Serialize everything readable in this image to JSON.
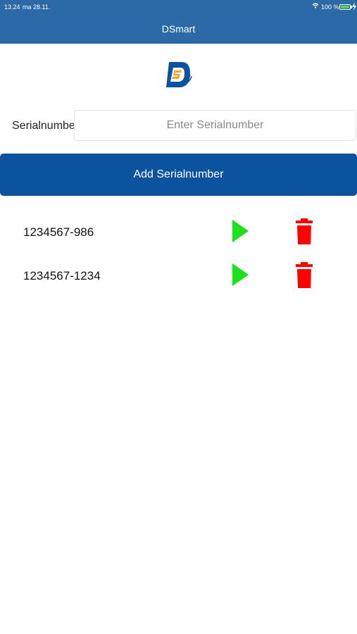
{
  "status_bar": {
    "time": "13.24",
    "date": "ma 28.11.",
    "battery_pct": "100 %",
    "icons": [
      "wifi-icon",
      "battery-icon",
      "charging-icon"
    ],
    "colors": {
      "battery_fill": "#52d64e"
    }
  },
  "nav": {
    "title": "DSmart"
  },
  "logo": {
    "letter": "D",
    "colors": {
      "primary": "#0b539f",
      "accent": "#f2a52a"
    }
  },
  "form": {
    "label": "Serialnumber",
    "input_value": "",
    "input_placeholder": "Enter Serialnumber",
    "add_button_label": "Add Serialnumber"
  },
  "serials": [
    {
      "serial": "1234567-986",
      "actions": [
        "play-icon",
        "trash-icon"
      ]
    },
    {
      "serial": "1234567-1234",
      "actions": [
        "play-icon",
        "trash-icon"
      ]
    }
  ],
  "colors": {
    "header": "#2b6aa6",
    "button": "#0b539f",
    "play": "#1ee01e",
    "delete": "#ff0000"
  }
}
